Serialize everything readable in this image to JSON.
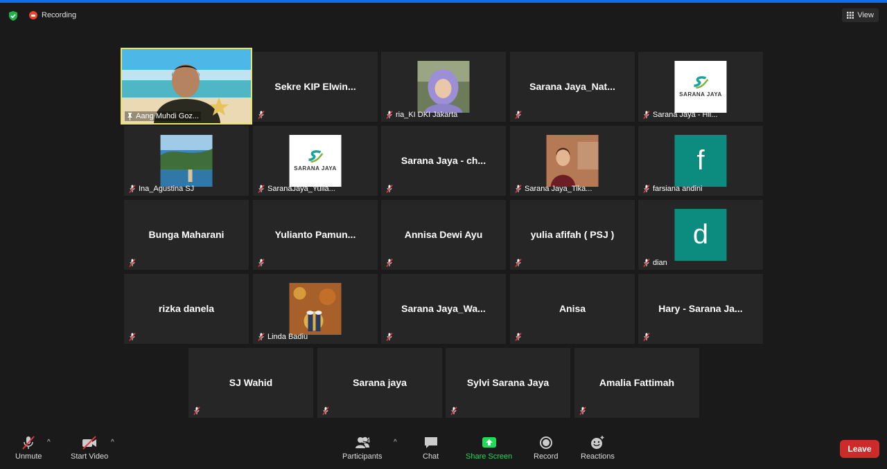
{
  "header": {
    "recording_label": "Recording",
    "view_label": "View"
  },
  "tiles": [
    {
      "name": "Aang Muhdi Goz...",
      "type": "video",
      "pinned": true,
      "active": true
    },
    {
      "name": "Sekre  KIP  Elwin...",
      "type": "name"
    },
    {
      "name": "ria_KI DKI Jakarta",
      "type": "photo",
      "icon": "woman-hijab-photo"
    },
    {
      "name": "Sarana  Jaya_Nat...",
      "type": "name"
    },
    {
      "name": "Sarana Jaya - Hil...",
      "type": "logo",
      "logo_text": "SARANA JAYA"
    },
    {
      "name": "Ina_Agustina SJ",
      "type": "photo",
      "icon": "coast-photo"
    },
    {
      "name": "SaranaJaya_Yulia...",
      "type": "logo",
      "logo_text": "SARANA JAYA"
    },
    {
      "name": "Sarana Jaya - ch...",
      "type": "name"
    },
    {
      "name": "Sarana Jaya_Tika...",
      "type": "photo",
      "icon": "woman-photo"
    },
    {
      "name": "farsiana andini",
      "type": "letter",
      "letter": "f"
    },
    {
      "name": "Bunga Maharani",
      "type": "name"
    },
    {
      "name": "Yulianto  Pamun...",
      "type": "name"
    },
    {
      "name": "Annisa Dewi Ayu",
      "type": "name"
    },
    {
      "name": "yulia afifah ( PSJ )",
      "type": "name"
    },
    {
      "name": "dian",
      "type": "letter",
      "letter": "d"
    },
    {
      "name": "rizka danela",
      "type": "name"
    },
    {
      "name": "Linda Badiu",
      "type": "photo",
      "icon": "autumn-leaves-photo"
    },
    {
      "name": "Sarana  Jaya_Wa...",
      "type": "name"
    },
    {
      "name": "Anisa",
      "type": "name"
    },
    {
      "name": "Hary  -  Sarana Ja...",
      "type": "name"
    },
    {
      "name": "SJ Wahid",
      "type": "name"
    },
    {
      "name": "Sarana jaya",
      "type": "name"
    },
    {
      "name": "Sylvi Sarana Jaya",
      "type": "name"
    },
    {
      "name": "Amalia Fattimah",
      "type": "name"
    }
  ],
  "toolbar": {
    "unmute": "Unmute",
    "start_video": "Start Video",
    "participants": "Participants",
    "participants_count": "24",
    "chat": "Chat",
    "share_screen": "Share Screen",
    "record": "Record",
    "reactions": "Reactions",
    "leave": "Leave"
  },
  "colors": {
    "accent_blue": "#0e71eb",
    "active_speaker": "#e6e46a",
    "share_green": "#23d959",
    "leave_red": "#cf2a2a",
    "letter_avatar": "#0b8c7e"
  }
}
